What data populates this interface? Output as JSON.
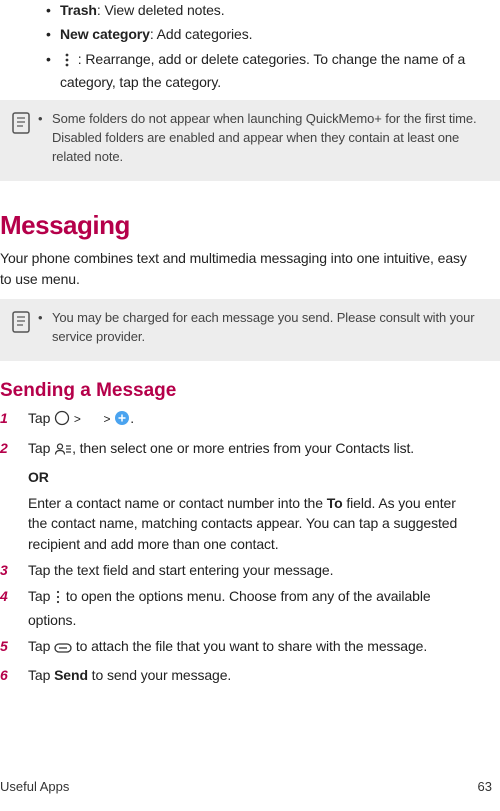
{
  "bullets": {
    "trash": {
      "label": "Trash",
      "desc": ": View deleted notes."
    },
    "newcat": {
      "label": "New category",
      "desc": ": Add categories."
    },
    "more": {
      "desc": " : Rearrange, add or delete categories. To change the name of a category, tap the category."
    }
  },
  "note1": "Some folders do not appear when launching QuickMemo+ for the first time. Disabled folders are enabled and appear when they contain at least one related note.",
  "section": {
    "title": "Messaging",
    "desc": "Your phone combines text and multimedia messaging into one intuitive, easy to use menu."
  },
  "note2": "You may be charged for each message you send. Please consult with your service provider.",
  "sub": "Sending a Message",
  "step1": {
    "a": "Tap ",
    "chev1": ">",
    "chev2": ">",
    "dot": "."
  },
  "step2": {
    "a": "Tap ",
    "b": ", then select one or more entries from your Contacts list.",
    "or": "OR",
    "c1": "Enter a contact name or contact number into the ",
    "to": "To",
    "c2": " field. As you enter the contact name, matching contacts appear. You can tap a suggested recipient and add more than one contact."
  },
  "step3": "Tap the text field and start entering your message.",
  "step4": {
    "a": "Tap ",
    "b": " to open the options menu. Choose from any of the available options."
  },
  "step5": {
    "a": "Tap ",
    "b": " to attach the file that you want to share with the message."
  },
  "step6": {
    "a": "Tap ",
    "send": "Send",
    "b": " to send your message."
  },
  "footer": {
    "section": "Useful Apps",
    "page": "63"
  }
}
